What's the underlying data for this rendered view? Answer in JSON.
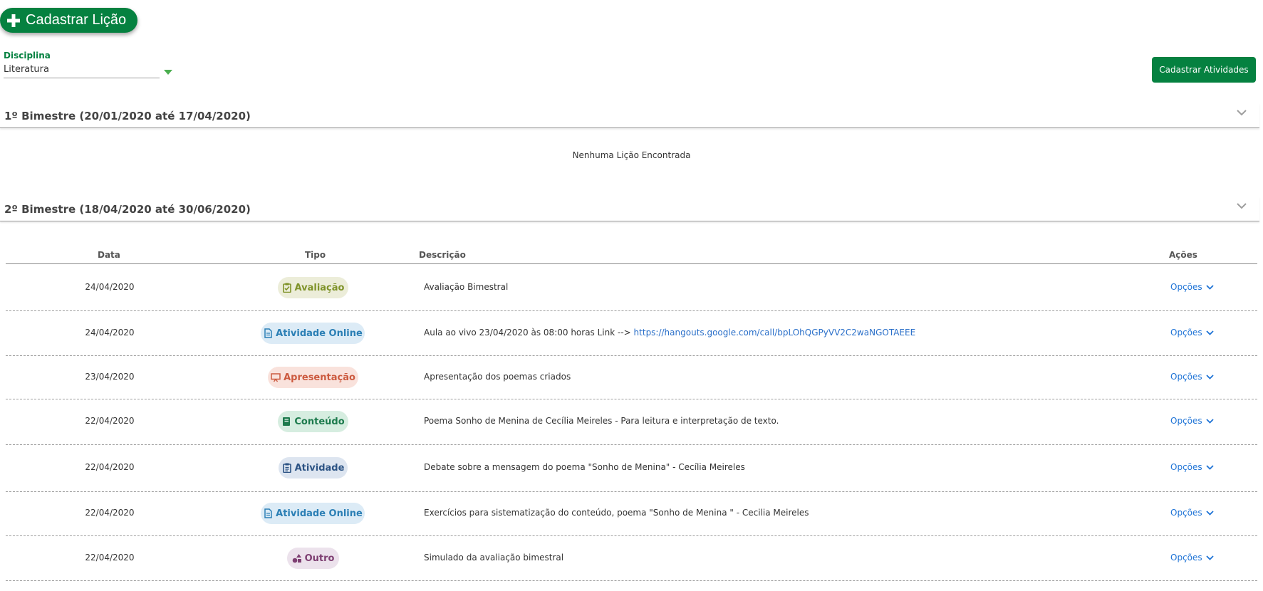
{
  "header": {
    "add_lesson_label": "Cadastrar Lição",
    "add_activities_label": "Cadastrar Atividades"
  },
  "discipline": {
    "label": "Disciplina",
    "value": "Literatura"
  },
  "bimesters": [
    {
      "title": "1º Bimestre (20/01/2020 até 17/04/2020)",
      "empty_message": "Nenhuma Lição Encontrada"
    },
    {
      "title": "2º Bimestre (18/04/2020 até 30/06/2020)"
    }
  ],
  "table": {
    "headers": {
      "date": "Data",
      "type": "Tipo",
      "description": "Descrição",
      "actions": "Ações"
    },
    "options_label": "Opções",
    "rows": [
      {
        "date": "24/04/2020",
        "type": "Avaliação",
        "type_key": "avaliacao",
        "description": "Avaliação Bimestral",
        "link": ""
      },
      {
        "date": "24/04/2020",
        "type": "Atividade Online",
        "type_key": "online",
        "description": "Aula ao vivo 23/04/2020 às 08:00 horas Link --> ",
        "link": "https://hangouts.google.com/call/bpLOhQGPyVV2C2waNGOTAEEE"
      },
      {
        "date": "23/04/2020",
        "type": "Apresentação",
        "type_key": "apresentacao",
        "description": "Apresentação dos poemas criados",
        "link": ""
      },
      {
        "date": "22/04/2020",
        "type": "Conteúdo",
        "type_key": "conteudo",
        "description": "Poema Sonho de Menina de Cecília Meireles - Para leitura e interpretação de texto.",
        "link": ""
      },
      {
        "date": "22/04/2020",
        "type": "Atividade",
        "type_key": "atividade",
        "description": "Debate sobre a mensagem do poema \"Sonho de Menina\" - Cecília Meireles",
        "link": ""
      },
      {
        "date": "22/04/2020",
        "type": "Atividade Online",
        "type_key": "online",
        "description": "Exercícios para sistematização do conteúdo, poema \"Sonho de Menina \" - Cecilia Meireles",
        "link": ""
      },
      {
        "date": "22/04/2020",
        "type": "Outro",
        "type_key": "outro",
        "description": "Simulado da avaliação bimestral",
        "link": ""
      }
    ]
  },
  "badge_styles": {
    "avaliacao": {
      "bg": "#ecedd9",
      "color": "#7e9228",
      "icon": "clipboard-check-icon"
    },
    "online": {
      "bg": "#dcebf6",
      "color": "#2b7fb5",
      "icon": "document-icon"
    },
    "apresentacao": {
      "bg": "#f9e2dc",
      "color": "#cc5a3f",
      "icon": "presentation-icon"
    },
    "conteudo": {
      "bg": "#d6ede0",
      "color": "#1c7a4c",
      "icon": "book-icon"
    },
    "atividade": {
      "bg": "#dde5f0",
      "color": "#2c5384",
      "icon": "clipboard-list-icon"
    },
    "outro": {
      "bg": "#ece2ec",
      "color": "#7e3f72",
      "icon": "shapes-icon"
    }
  }
}
